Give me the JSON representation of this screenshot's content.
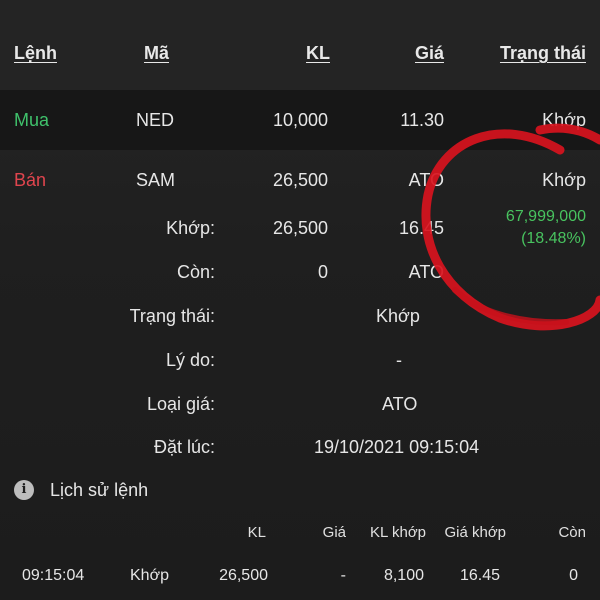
{
  "header": {
    "col_side": "Lệnh",
    "col_symbol": "Mã",
    "col_qty": "KL",
    "col_price": "Giá",
    "col_status": "Trạng thái"
  },
  "orders": [
    {
      "side": "Mua",
      "symbol": "NED",
      "qty": "10,000",
      "price": "11.30",
      "status": "Khớp"
    },
    {
      "side": "Bán",
      "symbol": "SAM",
      "qty": "26,500",
      "price": "ATO",
      "status": "Khớp"
    }
  ],
  "detail": {
    "matched_label": "Khớp:",
    "matched_qty": "26,500",
    "matched_price": "16.45",
    "profit_value": "67,999,000",
    "profit_pct": "(18.48%)",
    "remaining_label": "Còn:",
    "remaining_qty": "0",
    "remaining_price": "ATO",
    "status_label": "Trạng thái:",
    "status_value": "Khớp",
    "reason_label": "Lý do:",
    "reason_value": "-",
    "price_type_label": "Loại giá:",
    "price_type_value": "ATO",
    "placed_label": "Đặt lúc:",
    "placed_value": "19/10/2021 09:15:04"
  },
  "history": {
    "title": "Lịch sử lệnh",
    "icon": "info-icon",
    "columns": [
      "KL",
      "Giá",
      "KL khớp",
      "Giá khớp",
      "Còn"
    ],
    "rows": [
      {
        "time": "09:15:04",
        "status": "Khớp",
        "qty": "26,500",
        "price": "-",
        "matched_qty": "8,100",
        "matched_price": "16.45",
        "remaining": "0"
      }
    ]
  },
  "colors": {
    "buy": "#3fc16b",
    "sell": "#e0454e",
    "gain": "#48c35f",
    "annotation": "#d8141e"
  }
}
